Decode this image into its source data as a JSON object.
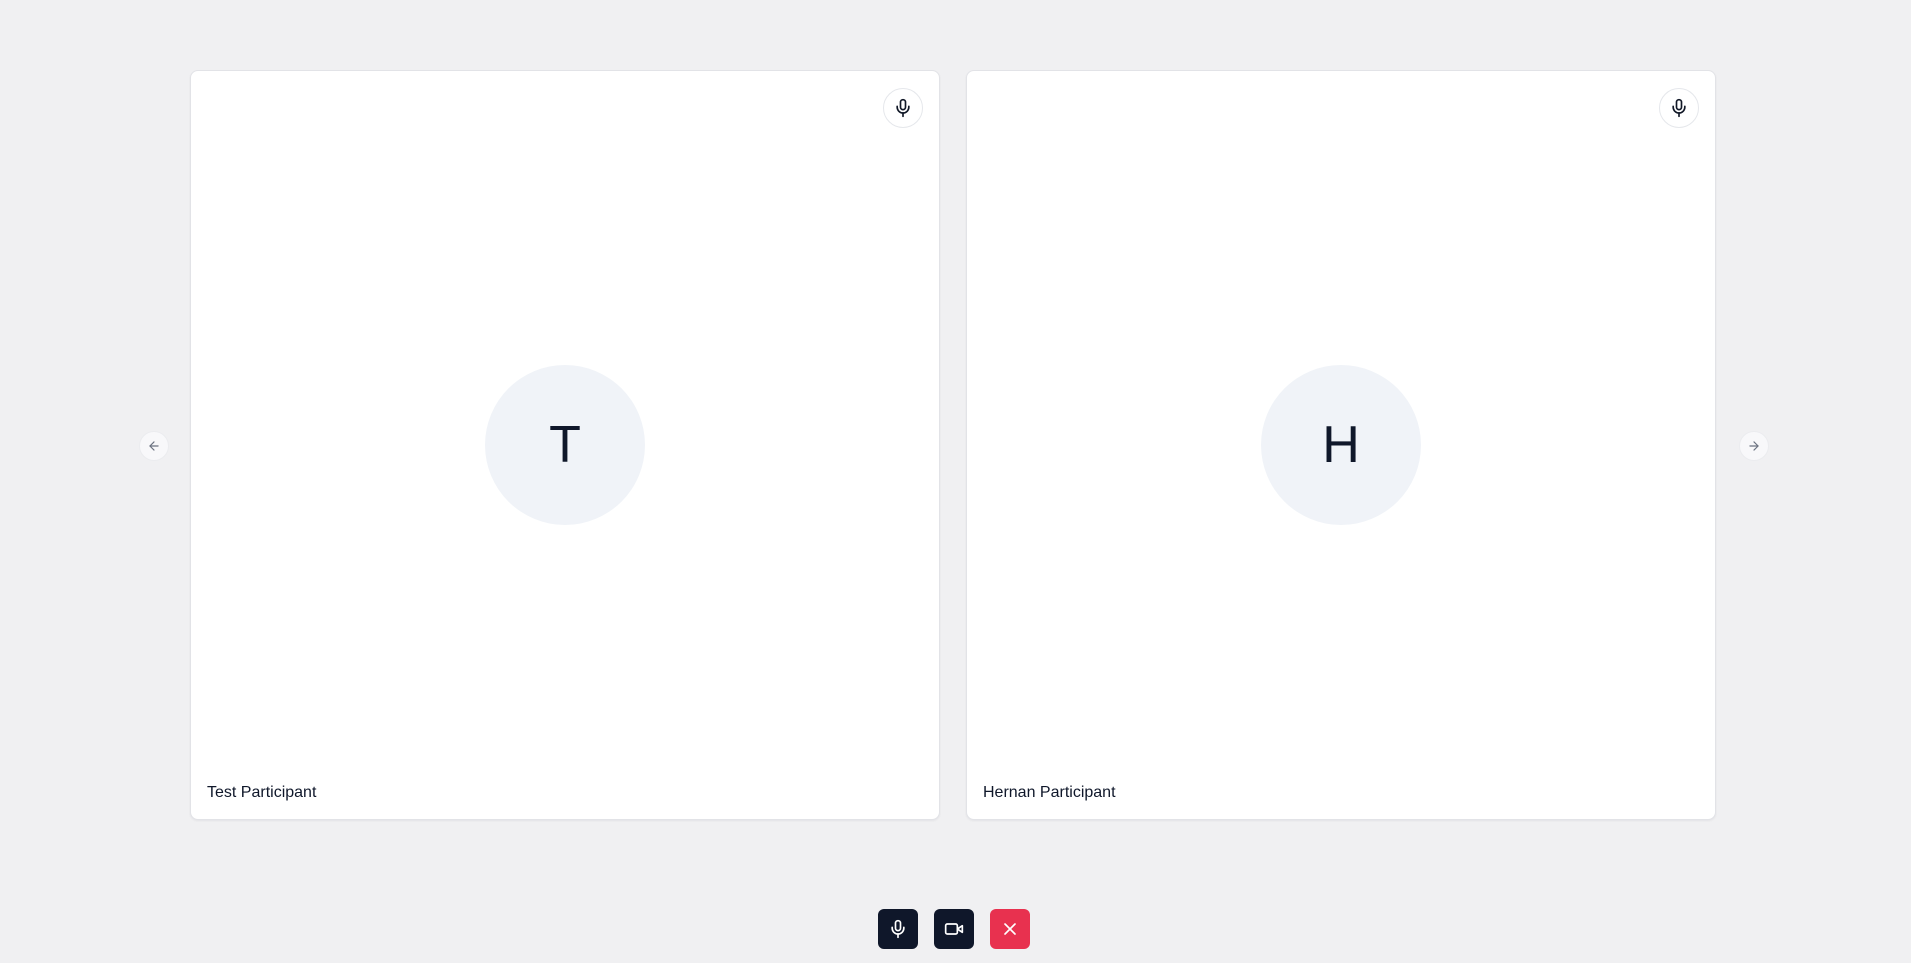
{
  "participants": [
    {
      "name": "Test Participant",
      "initial": "T",
      "mic_icon": "mic-icon"
    },
    {
      "name": "Hernan Participant",
      "initial": "H",
      "mic_icon": "mic-icon"
    }
  ],
  "navigation": {
    "prev_icon": "arrow-left-icon",
    "next_icon": "arrow-right-icon"
  },
  "controls": {
    "mic_icon": "mic-icon",
    "camera_icon": "video-camera-icon",
    "leave_icon": "close-icon"
  },
  "colors": {
    "background": "#f0f0f2",
    "tile": "#ffffff",
    "avatar_bg": "#f0f3f8",
    "control_dark": "#0f172a",
    "control_danger": "#e8314f"
  }
}
